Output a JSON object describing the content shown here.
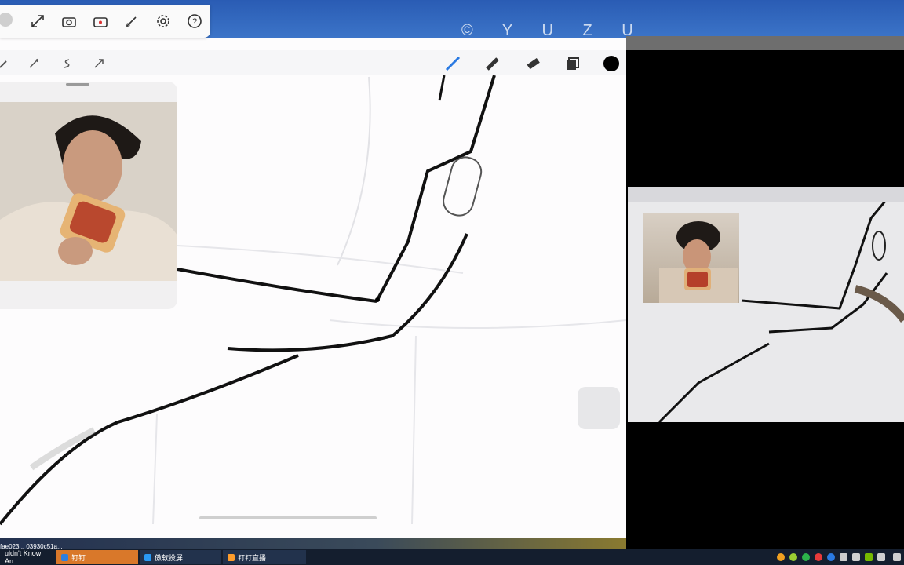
{
  "watermark": "© Y U Z U",
  "float_toolbar": {
    "icons": [
      "expand-icon",
      "camera-icon",
      "video-camera-icon",
      "brush-icon",
      "settings-icon",
      "help-icon"
    ]
  },
  "procreate_toolbar": {
    "left_icons": [
      "wrench-icon",
      "magic-wand-icon",
      "selection-icon",
      "transform-icon"
    ],
    "right_icons": [
      "brush-icon",
      "smudge-icon",
      "eraser-icon",
      "layers-icon",
      "color-icon"
    ],
    "current_color": "#000000"
  },
  "under_strip_text": "fae023...  03930c51a...",
  "taskbar": {
    "items": [
      {
        "label": "uldn't Know An...",
        "color": "#ffffff",
        "active": false
      },
      {
        "label": "钉钉",
        "color": "#2f7fe0",
        "active": true
      },
      {
        "label": "傲软投屏",
        "color": "#2a9af5",
        "active": false
      },
      {
        "label": "钉钉直播",
        "color": "#ff9d2b",
        "active": false
      }
    ]
  }
}
